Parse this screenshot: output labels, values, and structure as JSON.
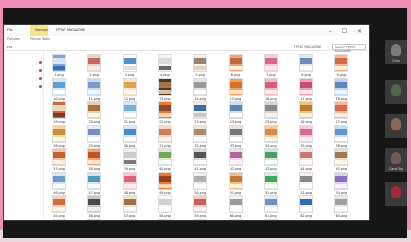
{
  "explorer": {
    "ribbon_tabs": [
      "File",
      "Home",
      "Share",
      "View",
      "Manage"
    ],
    "title": "FPTAT MAGAZINE",
    "subtabs": [
      "Pictures",
      "Picture Tools"
    ],
    "address_path": "FPTAT MAGAZINE",
    "search_placeholder": "Search FPTAT MAGAZINE",
    "nav_label": "ess",
    "window_controls": "– ☐ ✕",
    "files": [
      {
        "name": "1.png",
        "colors": [
          "#7aa6d8",
          "#d6e6f4",
          "#3f6fb0"
        ]
      },
      {
        "name": "2.png",
        "colors": [
          "#ecd2c8",
          "#c46a5a",
          "#f2ece6"
        ]
      },
      {
        "name": "3.png",
        "colors": [
          "#ffffff",
          "#4e93c9",
          "#e0e0e0"
        ]
      },
      {
        "name": "4.png",
        "colors": [
          "#f4f4f4",
          "#d9d9d9",
          "#666666"
        ]
      },
      {
        "name": "5.png",
        "colors": [
          "#f7f1e8",
          "#9a8170",
          "#e2d2c0"
        ]
      },
      {
        "name": "6.png",
        "colors": [
          "#f0a56e",
          "#c3673f",
          "#fff1e4"
        ]
      },
      {
        "name": "7.png",
        "colors": [
          "#f6c7d6",
          "#d9688e",
          "#fbeaf0"
        ]
      },
      {
        "name": "8.png",
        "colors": [
          "#dfe9f4",
          "#6c8db8",
          "#ffffff"
        ]
      },
      {
        "name": "9.png",
        "colors": [
          "#f6b78f",
          "#ce6b4a",
          "#fff0e6"
        ]
      },
      {
        "name": "10.png",
        "colors": [
          "#d4e8f7",
          "#5d9ed8",
          "#ffffff"
        ]
      },
      {
        "name": "11.png",
        "colors": [
          "#c9d9ef",
          "#7a9ccd",
          "#f0f5fb"
        ]
      },
      {
        "name": "12.png",
        "colors": [
          "#f7e6c6",
          "#d8a455",
          "#fff8ec"
        ]
      },
      {
        "name": "13.png",
        "colors": [
          "#4b3826",
          "#a4774a",
          "#d8c0a0"
        ]
      },
      {
        "name": "14.png",
        "colors": [
          "#e6e6e6",
          "#9a9a9a",
          "#ffffff"
        ]
      },
      {
        "name": "15.png",
        "colors": [
          "#f3a35a",
          "#d1732a",
          "#fde4c9"
        ]
      },
      {
        "name": "16.png",
        "colors": [
          "#f7b2c4",
          "#d25f7e",
          "#fde9ef"
        ]
      },
      {
        "name": "17.png",
        "colors": [
          "#f5a0b6",
          "#c44f74",
          "#fde7ee"
        ]
      },
      {
        "name": "18.png",
        "colors": [
          "#bcd4ef",
          "#5e86be",
          "#eef4fb"
        ]
      },
      {
        "name": "19.png",
        "colors": [
          "#c96a3c",
          "#f0d6b8",
          "#7a3d1f"
        ]
      },
      {
        "name": "20.png",
        "colors": [
          "#e8d0b0",
          "#a8703c",
          "#fff6ea"
        ]
      },
      {
        "name": "21.png",
        "colors": [
          "#d9e9f7",
          "#7ab0d8",
          "#ffffff"
        ]
      },
      {
        "name": "22.png",
        "colors": [
          "#e97a3a",
          "#8a4a2a",
          "#fbd9b8"
        ]
      },
      {
        "name": "23.png",
        "colors": [
          "#f2efe9",
          "#3b6ea8",
          "#d0c8bc"
        ]
      },
      {
        "name": "24.png",
        "colors": [
          "#cfe0ee",
          "#5b86ad",
          "#ffffff"
        ]
      },
      {
        "name": "25.png",
        "colors": [
          "#d6d6d6",
          "#8a8a8a",
          "#f4f4f4"
        ]
      },
      {
        "name": "26.png",
        "colors": [
          "#f1c27d",
          "#c07a30",
          "#fff3e0"
        ]
      },
      {
        "name": "27.png",
        "colors": [
          "#f7b89a",
          "#d46a4e",
          "#fff0e8"
        ]
      },
      {
        "name": "28.png",
        "colors": [
          "#f4d6a0",
          "#c9903c",
          "#fff7e8"
        ]
      },
      {
        "name": "29.png",
        "colors": [
          "#e7eef7",
          "#7391bd",
          "#ffffff"
        ]
      },
      {
        "name": "30.png",
        "colors": [
          "#d6e7f5",
          "#4b8ac6",
          "#ffffff"
        ]
      },
      {
        "name": "31.png",
        "colors": [
          "#f6d9c8",
          "#d27c5a",
          "#fff4ec"
        ]
      },
      {
        "name": "32.png",
        "colors": [
          "#f0e6d8",
          "#a88b6a",
          "#ffffff"
        ]
      },
      {
        "name": "33.png",
        "colors": [
          "#e4e4e4",
          "#777777",
          "#ffffff"
        ]
      },
      {
        "name": "34.png",
        "colors": [
          "#f7c9a4",
          "#d98850",
          "#fff3ea"
        ]
      },
      {
        "name": "35.png",
        "colors": [
          "#f8c8dc",
          "#d86a98",
          "#fdeef4"
        ]
      },
      {
        "name": "36.png",
        "colors": [
          "#c8def2",
          "#5f96cc",
          "#ffffff"
        ]
      },
      {
        "name": "37.png",
        "colors": [
          "#f4c6a0",
          "#c46030",
          "#fff0e4"
        ]
      },
      {
        "name": "38.png",
        "colors": [
          "#f2a36a",
          "#b9552a",
          "#fde2cc"
        ]
      },
      {
        "name": "39.png",
        "colors": [
          "#f5f5f5",
          "#cccccc",
          "#7a7a7a"
        ]
      },
      {
        "name": "40.png",
        "colors": [
          "#dde9d0",
          "#7aa35a",
          "#ffffff"
        ]
      },
      {
        "name": "41.png",
        "colors": [
          "#d9d9d9",
          "#555555",
          "#ffffff"
        ]
      },
      {
        "name": "42.png",
        "colors": [
          "#f0d8e6",
          "#b46694",
          "#fff2f8"
        ]
      },
      {
        "name": "43.png",
        "colors": [
          "#cde4d6",
          "#4f9a6e",
          "#ffffff"
        ]
      },
      {
        "name": "44.png",
        "colors": [
          "#f6e4e0",
          "#c97a6e",
          "#fff9f8"
        ]
      },
      {
        "name": "45.png",
        "colors": [
          "#e9dcc8",
          "#9e7b52",
          "#fff7ee"
        ]
      },
      {
        "name": "46.png",
        "colors": [
          "#d7e6f4",
          "#6b9acb",
          "#ffffff"
        ]
      },
      {
        "name": "47.png",
        "colors": [
          "#cfe6ee",
          "#4e9ab8",
          "#ffffff"
        ]
      },
      {
        "name": "48.png",
        "colors": [
          "#f8c5cc",
          "#d8627a",
          "#fdeef0"
        ]
      },
      {
        "name": "49.png",
        "colors": [
          "#e87a3f",
          "#9a3f1c",
          "#fbd5b4"
        ]
      },
      {
        "name": "50.png",
        "colors": [
          "#f0f0f0",
          "#b0b0b0",
          "#ffffff"
        ]
      },
      {
        "name": "51.png",
        "colors": [
          "#f3c08a",
          "#c47a34",
          "#fff3e2"
        ]
      },
      {
        "name": "52.png",
        "colors": [
          "#d4f0d8",
          "#3fa85a",
          "#ffffff"
        ]
      },
      {
        "name": "53.png",
        "colors": [
          "#f4f4f4",
          "#8a8a8a",
          "#ffffff"
        ]
      },
      {
        "name": "54.png",
        "colors": [
          "#ded0f0",
          "#8e6cc4",
          "#f7f2fd"
        ]
      },
      {
        "name": "55.png",
        "colors": [
          "#f7d2b8",
          "#cc7040",
          "#fff2ea"
        ]
      },
      {
        "name": "56.png",
        "colors": [
          "#c8c8c8",
          "#4a4a4a",
          "#f0f0f0"
        ]
      },
      {
        "name": "57.png",
        "colors": [
          "#f0e0d0",
          "#a86e44",
          "#fffaf4"
        ]
      },
      {
        "name": "58.png",
        "colors": [
          "#f7f7f7",
          "#d0d0d0",
          "#ffffff"
        ]
      },
      {
        "name": "59.png",
        "colors": [
          "#f4cccc",
          "#cc5e5e",
          "#fff4f4"
        ]
      },
      {
        "name": "60.png",
        "colors": [
          "#f5f5f5",
          "#9a9a9a",
          "#ffffff"
        ]
      },
      {
        "name": "61.png",
        "colors": [
          "#e2ecf6",
          "#6f95c0",
          "#ffffff"
        ]
      },
      {
        "name": "62.png",
        "colors": [
          "#f2f2f2",
          "#2f6fb0",
          "#ffffff"
        ]
      },
      {
        "name": "63.png",
        "colors": [
          "#e8e8e8",
          "#a0a0a0",
          "#ffffff"
        ]
      },
      {
        "name": "64.png",
        "colors": [
          "#f0f0f0",
          "#3a3a3a",
          "#ffffff"
        ]
      },
      {
        "name": "65.png",
        "colors": [
          "#eaeaea",
          "#8a8a8a",
          "#ffffff"
        ]
      },
      {
        "name": "66.png",
        "colors": [
          "#f7f7f7",
          "#b8b8b8",
          "#ffffff"
        ]
      },
      {
        "name": "67.png",
        "colors": [
          "#f0f0f0",
          "#6a6a6a",
          "#ffffff"
        ]
      },
      {
        "name": "68.png",
        "colors": [
          "#f6f6f6",
          "#c4c4c4",
          "#ffffff"
        ]
      },
      {
        "name": "69.png",
        "colors": [
          "#eef4fa",
          "#7aa3cc",
          "#ffffff"
        ]
      },
      {
        "name": "70.png",
        "colors": [
          "#e6f2f8",
          "#4a98c4",
          "#ffffff"
        ]
      }
    ]
  },
  "participants": [
    {
      "name": "Chiu",
      "color": "#7f7a78"
    },
    {
      "name": "",
      "color": "#4f6a4a"
    },
    {
      "name": "",
      "color": "#8a6a55"
    },
    {
      "name": "Carol Bo",
      "color": "#6f5a55"
    },
    {
      "name": "",
      "color": "#a32838"
    }
  ],
  "more_button": "⋮"
}
